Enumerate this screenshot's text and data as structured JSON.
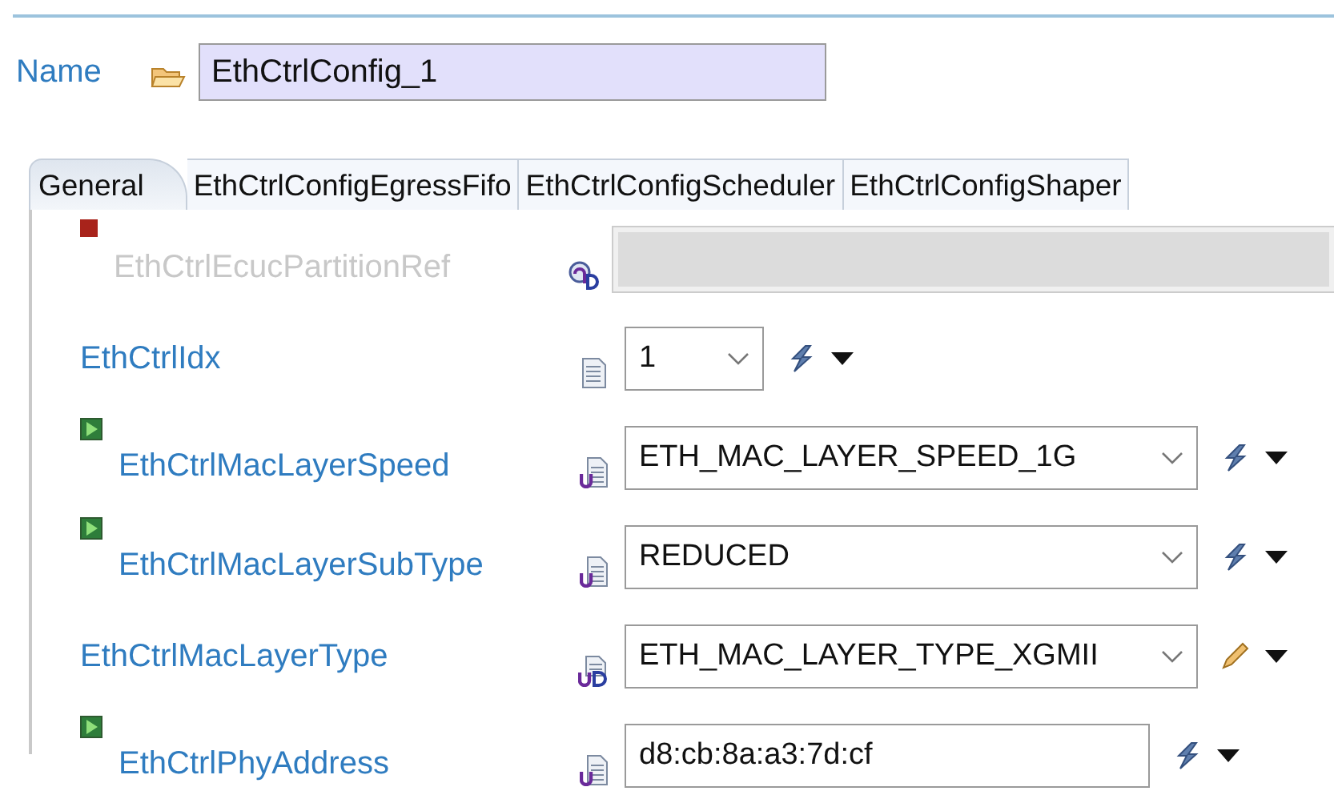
{
  "name_field": {
    "label": "Name",
    "value": "EthCtrlConfig_1"
  },
  "tabs": [
    {
      "label": "General",
      "selected": true
    },
    {
      "label": "EthCtrlConfigEgressFifo",
      "selected": false
    },
    {
      "label": "EthCtrlConfigScheduler",
      "selected": false
    },
    {
      "label": "EthCtrlConfigShaper",
      "selected": false
    }
  ],
  "parameters": [
    {
      "marker": {
        "kind": "square"
      },
      "label": "EthCtrlEcucPartitionRef",
      "disabled": true,
      "type_icon": {
        "kind": "reference"
      },
      "field": {
        "kind": "empty"
      }
    },
    {
      "label": "EthCtrlIdx",
      "disabled": false,
      "type_icon": {
        "kind": "number"
      },
      "field": {
        "kind": "combo",
        "value": "1"
      },
      "action": {
        "kind": "calculate"
      }
    },
    {
      "marker": {
        "kind": "play"
      },
      "label": "EthCtrlMacLayerSpeed",
      "disabled": false,
      "type_icon": {
        "kind": "user"
      },
      "field": {
        "kind": "combo",
        "value": "ETH_MAC_LAYER_SPEED_1G"
      },
      "action": {
        "kind": "calculate"
      }
    },
    {
      "marker": {
        "kind": "play"
      },
      "label": "EthCtrlMacLayerSubType",
      "disabled": false,
      "type_icon": {
        "kind": "user"
      },
      "field": {
        "kind": "combo",
        "value": "REDUCED"
      },
      "action": {
        "kind": "calculate"
      }
    },
    {
      "label": "EthCtrlMacLayerType",
      "disabled": false,
      "type_icon": {
        "kind": "userdefined"
      },
      "field": {
        "kind": "combo",
        "value": "ETH_MAC_LAYER_TYPE_XGMII"
      },
      "action": {
        "kind": "edit"
      }
    },
    {
      "marker": {
        "kind": "play"
      },
      "label": "EthCtrlPhyAddress",
      "disabled": false,
      "type_icon": {
        "kind": "user"
      },
      "field": {
        "kind": "text",
        "value": "d8:cb:8a:a3:7d:cf"
      },
      "action": {
        "kind": "calculate"
      }
    }
  ]
}
